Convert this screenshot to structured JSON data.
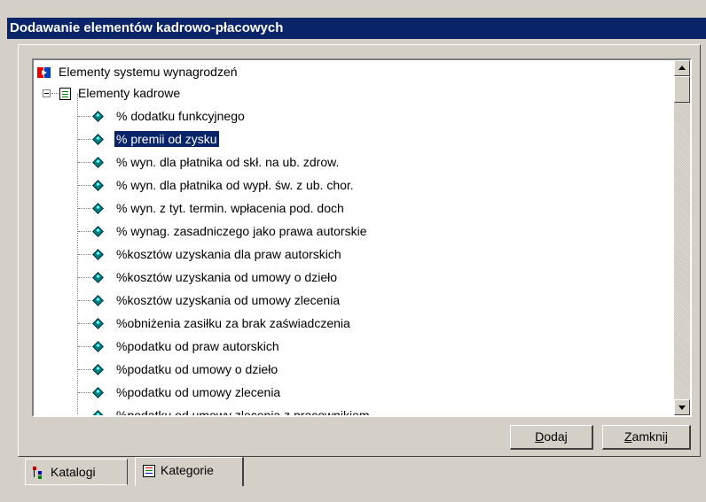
{
  "window": {
    "title": "Dodawanie elementów kadrowo-płacowych"
  },
  "tree": {
    "root_label": "Elementy systemu wynagrodzeń",
    "group_label": "Elementy kadrowe",
    "items": [
      "% dodatku funkcyjnego",
      "% premii od zysku",
      "% wyn. dla płatnika od skł. na ub. zdrow.",
      "% wyn. dla płatnika od wypł. św. z ub. chor.",
      "% wyn. z tyt. termin. wpłacenia pod. doch",
      "% wynag. zasadniczego jako prawa autorskie",
      "%kosztów uzyskania dla praw autorskich",
      "%kosztów uzyskania od umowy o dzieło",
      "%kosztów uzyskania od umowy zlecenia",
      "%obniżenia zasiłku za brak zaświadczenia",
      "%podatku od praw autorskich",
      "%podatku od umowy o dzieło",
      "%podatku od umowy zlecenia",
      "%podatku od umowy zlecenia z pracownikiem"
    ],
    "selected_index": 1
  },
  "buttons": {
    "add": "Dodaj",
    "close": "Zamknij"
  },
  "tabs": [
    {
      "label": "Katalogi",
      "icon": "tree-icon"
    },
    {
      "label": "Kategorie",
      "icon": "list-icon"
    }
  ],
  "active_tab": 1
}
